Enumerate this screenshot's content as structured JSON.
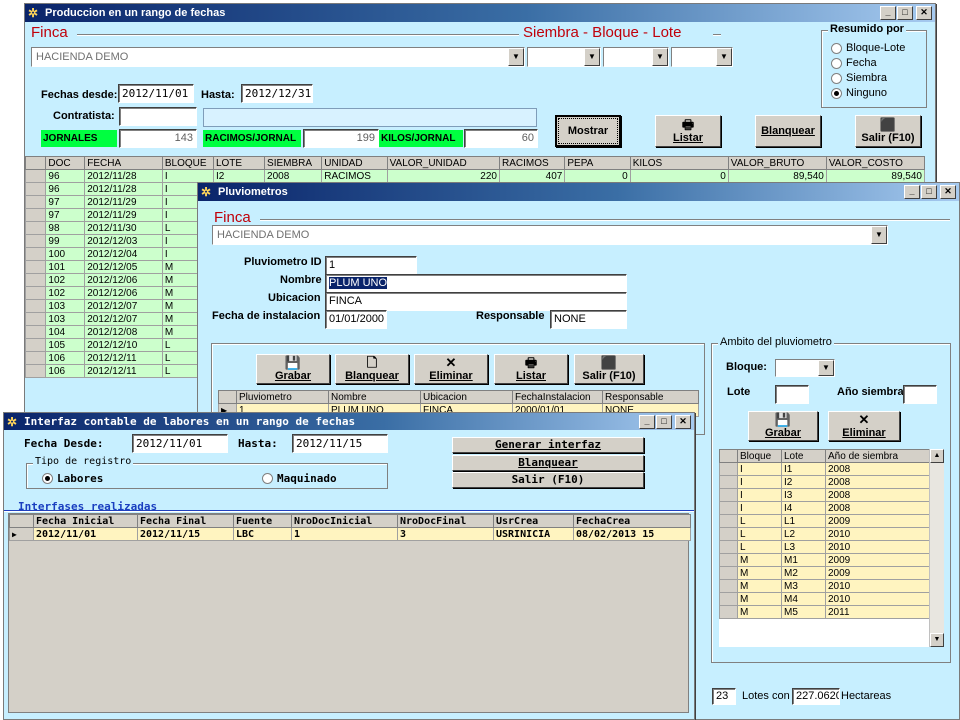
{
  "win1": {
    "title": "Produccion en un rango de fechas",
    "finca_title": "Finca",
    "siembra_title": "Siembra - Bloque - Lote",
    "finca_value": "HACIENDA DEMO",
    "resumido_title": "Resumido por",
    "resumido_options": [
      "Bloque-Lote",
      "Fecha",
      "Siembra",
      "Ninguno"
    ],
    "resumido_selected": 3,
    "fechas_desde_label": "Fechas desde:",
    "fechas_desde": "2012/11/01",
    "hasta_label": "Hasta:",
    "hasta": "2012/12/31",
    "contratista_label": "Contratista:",
    "jornales_label": "JORNALES",
    "jornales_value": "143",
    "racimos_label": "RACIMOS/JORNAL",
    "racimos_value": "199",
    "kilos_label": "KILOS/JORNAL",
    "kilos_value": "60",
    "buttons": {
      "mostrar": "Mostrar",
      "listar": "Listar",
      "blanquear": "Blanquear",
      "salir": "Salir (F10)"
    },
    "columns": [
      "DOC",
      "FECHA",
      "BLOQUE",
      "LOTE",
      "SIEMBRA",
      "UNIDAD",
      "VALOR_UNIDAD",
      "RACIMOS",
      "PEPA",
      "KILOS",
      "VALOR_BRUTO",
      "VALOR_COSTO"
    ],
    "first_row": [
      "96",
      "2012/11/28",
      "I",
      "I2",
      "2008",
      "RACIMOS",
      "220",
      "407",
      "0",
      "0",
      "89,540",
      "89,540"
    ],
    "rows": [
      [
        "96",
        "2012/11/28",
        "I"
      ],
      [
        "97",
        "2012/11/29",
        "I"
      ],
      [
        "97",
        "2012/11/29",
        "I"
      ],
      [
        "98",
        "2012/11/30",
        "L"
      ],
      [
        "99",
        "2012/12/03",
        "I"
      ],
      [
        "100",
        "2012/12/04",
        "I"
      ],
      [
        "101",
        "2012/12/05",
        "M"
      ],
      [
        "102",
        "2012/12/06",
        "M"
      ],
      [
        "102",
        "2012/12/06",
        "M"
      ],
      [
        "103",
        "2012/12/07",
        "M"
      ],
      [
        "103",
        "2012/12/07",
        "M"
      ],
      [
        "104",
        "2012/12/08",
        "M"
      ],
      [
        "105",
        "2012/12/10",
        "L"
      ],
      [
        "106",
        "2012/12/11",
        "L"
      ],
      [
        "106",
        "2012/12/11",
        "L"
      ]
    ]
  },
  "win2": {
    "title": "Pluviometros",
    "finca_title": "Finca",
    "finca_value": "HACIENDA DEMO",
    "id_label": "Pluviometro ID",
    "id_value": "1",
    "nombre_label": "Nombre",
    "nombre_value": "PLUM UNO",
    "ubicacion_label": "Ubicacion",
    "ubicacion_value": "FINCA",
    "fecha_label": "Fecha de instalacion",
    "fecha_value": "01/01/2000",
    "responsable_label": "Responsable",
    "responsable_value": "NONE",
    "buttons": {
      "grabar": "Grabar",
      "blanquear": "Blanquear",
      "eliminar": "Eliminar",
      "listar": "Listar",
      "salir": "Salir (F10)"
    },
    "grid_columns": [
      "Pluviometro",
      "Nombre",
      "Ubicacion",
      "FechaInstalacion",
      "Responsable"
    ],
    "grid_row": [
      "1",
      "PLUM UNO",
      "FINCA",
      "2000/01/01",
      "NONE"
    ],
    "ambito_title": "Ambito del pluviometro",
    "bloque_label": "Bloque:",
    "lote_label": "Lote",
    "anio_label": "Año siembra",
    "ambito_buttons": {
      "grabar": "Grabar",
      "eliminar": "Eliminar"
    },
    "lotes_columns": [
      "Bloque",
      "Lote",
      "Año de siembra"
    ],
    "lotes_rows": [
      [
        "I",
        "I1",
        "2008"
      ],
      [
        "I",
        "I2",
        "2008"
      ],
      [
        "I",
        "I3",
        "2008"
      ],
      [
        "I",
        "I4",
        "2008"
      ],
      [
        "L",
        "L1",
        "2009"
      ],
      [
        "L",
        "L2",
        "2010"
      ],
      [
        "L",
        "L3",
        "2010"
      ],
      [
        "M",
        "M1",
        "2009"
      ],
      [
        "M",
        "M2",
        "2009"
      ],
      [
        "M",
        "M3",
        "2010"
      ],
      [
        "M",
        "M4",
        "2010"
      ],
      [
        "M",
        "M5",
        "2011"
      ]
    ],
    "lotes_count": "23",
    "lotes_con_label": "Lotes con",
    "hectareas_value": "227.0620",
    "hectareas_label": "Hectareas"
  },
  "win3": {
    "title": "Interfaz contable de labores en un rango de fechas",
    "fecha_desde_label": "Fecha Desde:",
    "fecha_desde": "2012/11/01",
    "hasta_label": "Hasta:",
    "hasta": "2012/11/15",
    "tipo_title": "Tipo de registro",
    "radio_labores": "Labores",
    "radio_maquinado": "Maquinado",
    "buttons": {
      "generar": "Generar interfaz",
      "blanquear": "Blanquear",
      "salir": "Salir (F10)"
    },
    "interfaces_title": "Interfases realizadas",
    "columns": [
      "Fecha Inicial",
      "Fecha Final",
      "Fuente",
      "NroDocInicial",
      "NroDocFinal",
      "UsrCrea",
      "FechaCrea"
    ],
    "row": [
      "2012/11/01",
      "2012/11/15",
      "LBC",
      "1",
      "3",
      "USRINICIA",
      "08/02/2013 15"
    ]
  },
  "colors": {
    "client": "#c7efff",
    "green": "#00ff40",
    "lotes_bg": "#fff4c0",
    "accent_red": "#c0000a"
  }
}
